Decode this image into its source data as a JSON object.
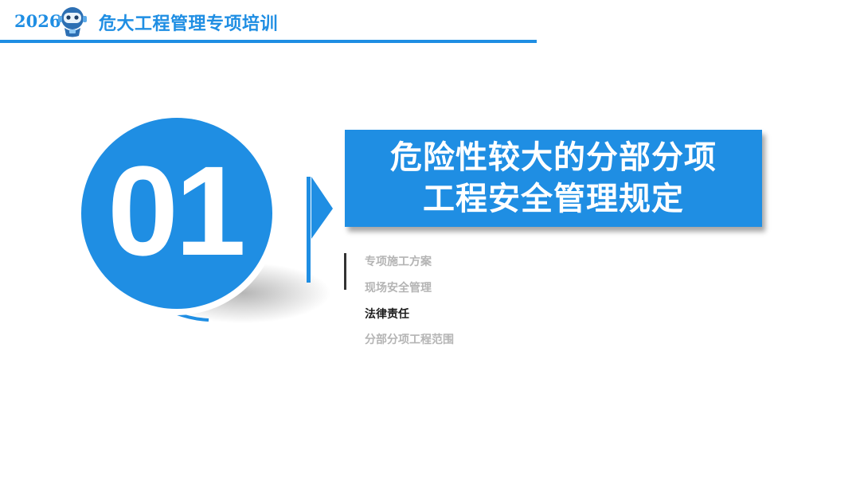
{
  "header": {
    "year": "2026",
    "title": "危大工程管理专项培训",
    "mascot_icon": "robot-mascot-icon",
    "accent_color": "#1f8ee3"
  },
  "section": {
    "number": "01",
    "title_lines": [
      "危险性较大的分部分项",
      "工程安全管理规定"
    ]
  },
  "agenda": {
    "items": [
      {
        "label": "专项施工方案",
        "active": false
      },
      {
        "label": "现场安全管理",
        "active": false
      },
      {
        "label": "法律责任",
        "active": true
      },
      {
        "label": "分部分项工程范围",
        "active": false
      }
    ]
  }
}
